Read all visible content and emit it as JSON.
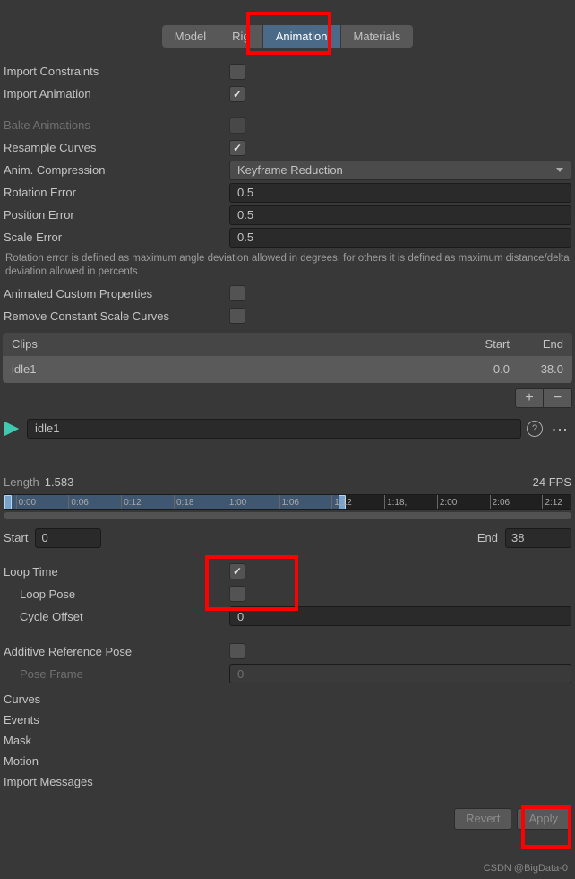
{
  "tabs": {
    "model": "Model",
    "rig": "Rig",
    "animation": "Animation",
    "materials": "Materials"
  },
  "labels": {
    "import_constraints": "Import Constraints",
    "import_animation": "Import Animation",
    "bake_animations": "Bake Animations",
    "resample_curves": "Resample Curves",
    "anim_compression": "Anim. Compression",
    "rotation_error": "Rotation Error",
    "position_error": "Position Error",
    "scale_error": "Scale Error",
    "animated_custom_properties": "Animated Custom Properties",
    "remove_constant_scale_curves": "Remove Constant Scale Curves",
    "loop_time": "Loop Time",
    "loop_pose": "Loop Pose",
    "cycle_offset": "Cycle Offset",
    "additive_reference_pose": "Additive Reference Pose",
    "pose_frame": "Pose Frame",
    "curves": "Curves",
    "events": "Events",
    "mask": "Mask",
    "motion": "Motion",
    "import_messages": "Import Messages",
    "revert": "Revert",
    "apply": "Apply"
  },
  "values": {
    "anim_compression": "Keyframe Reduction",
    "rotation_error": "0.5",
    "position_error": "0.5",
    "scale_error": "0.5",
    "cycle_offset": "0",
    "pose_frame": "0"
  },
  "help_text": "Rotation error is defined as maximum angle deviation allowed in degrees, for others it is defined as maximum distance/delta deviation allowed in percents",
  "clips": {
    "header_name": "Clips",
    "header_start": "Start",
    "header_end": "End",
    "row_name": "idle1",
    "row_start": "0.0",
    "row_end": "38.0"
  },
  "clip_editor": {
    "name": "idle1",
    "length_label": "Length",
    "length_value": "1.583",
    "fps": "24 FPS",
    "start_label": "Start",
    "start_value": "0",
    "end_label": "End",
    "end_value": "38"
  },
  "timeline_ticks": [
    "0:00",
    "0:06",
    "0:12",
    "0:18",
    "1:00",
    "1:06",
    "1:12",
    "1:18,",
    "2:00",
    "2:06",
    "2:12"
  ],
  "watermark": "CSDN @BigData-0"
}
